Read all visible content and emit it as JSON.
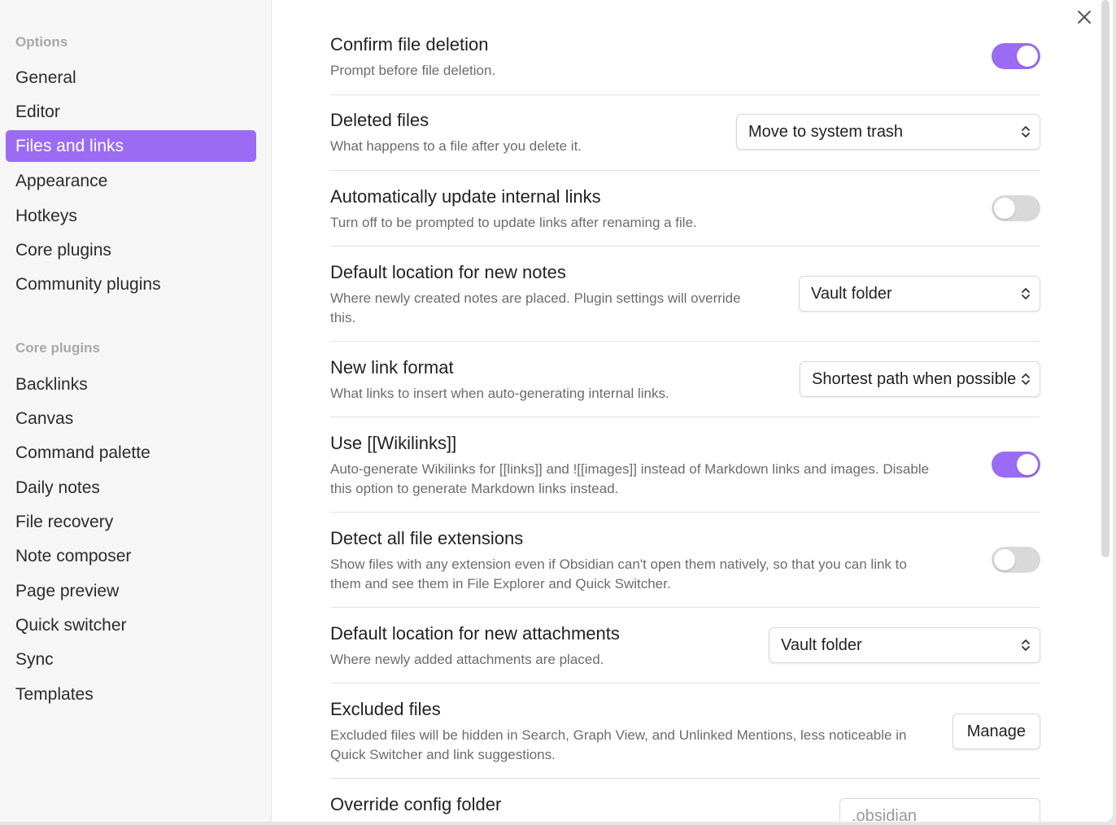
{
  "sidebar": {
    "options_heading": "Options",
    "options": [
      "General",
      "Editor",
      "Files and links",
      "Appearance",
      "Hotkeys",
      "Core plugins",
      "Community plugins"
    ],
    "active": "Files and links",
    "core_heading": "Core plugins",
    "core_plugins": [
      "Backlinks",
      "Canvas",
      "Command palette",
      "Daily notes",
      "File recovery",
      "Note composer",
      "Page preview",
      "Quick switcher",
      "Sync",
      "Templates"
    ]
  },
  "close_icon": "close-icon",
  "accent_color": "#9b6cf3",
  "settings": {
    "confirm_deletion": {
      "name": "Confirm file deletion",
      "desc": "Prompt before file deletion.",
      "enabled": true
    },
    "deleted_files": {
      "name": "Deleted files",
      "desc": "What happens to a file after you delete it.",
      "value": "Move to system trash"
    },
    "auto_update_links": {
      "name": "Automatically update internal links",
      "desc": "Turn off to be prompted to update links after renaming a file.",
      "enabled": false
    },
    "default_location_notes": {
      "name": "Default location for new notes",
      "desc_line1": "Where newly created notes are placed. Plugin settings will override",
      "desc_line2": "this.",
      "value": "Vault folder"
    },
    "new_link_format": {
      "name": "New link format",
      "desc": "What links to insert when auto-generating internal links.",
      "value": "Shortest path when possible"
    },
    "use_wikilinks": {
      "name": "Use [[Wikilinks]]",
      "desc_line1": "Auto-generate Wikilinks for [[links]] and ![[images]] instead of Markdown links and images. Disable",
      "desc_line2": "this option to generate Markdown links instead.",
      "enabled": true
    },
    "detect_extensions": {
      "name": "Detect all file extensions",
      "desc_line1": "Show files with any extension even if Obsidian can't open them natively, so that you can link to",
      "desc_line2": "them and see them in File Explorer and Quick Switcher.",
      "enabled": false
    },
    "default_location_attachments": {
      "name": "Default location for new attachments",
      "desc": "Where newly added attachments are placed.",
      "value": "Vault folder"
    },
    "excluded_files": {
      "name": "Excluded files",
      "desc_line1": "Excluded files will be hidden in Search, Graph View, and Unlinked Mentions, less noticeable in",
      "desc_line2": "Quick Switcher and link suggestions.",
      "button": "Manage"
    },
    "override_config": {
      "name": "Override config folder",
      "placeholder": ".obsidian"
    }
  }
}
